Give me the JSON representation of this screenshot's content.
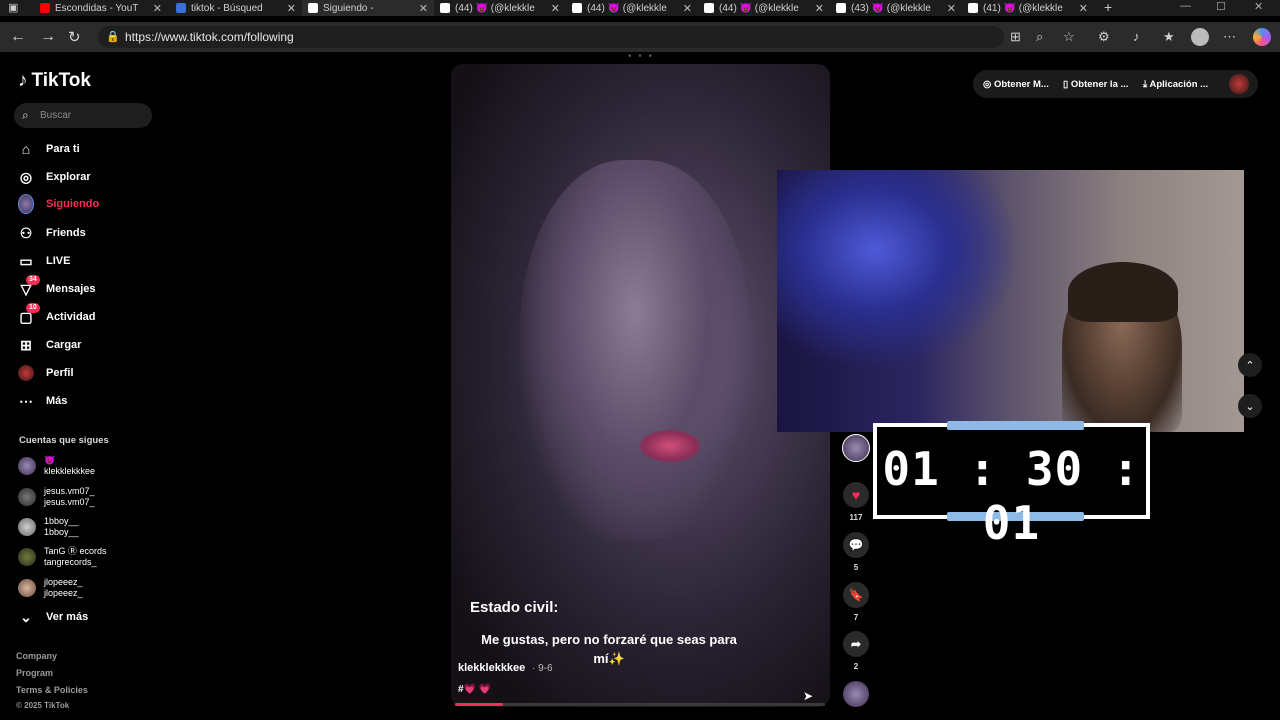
{
  "browser": {
    "tabs": [
      {
        "title": "Escondidas - YouT",
        "favicon_color": "#ff0000"
      },
      {
        "title": "tiktok - Búsqued",
        "favicon_color": "#3a6fd8"
      },
      {
        "title": "Siguiendo - ",
        "favicon_color": "#ffffff"
      },
      {
        "title": "(44) 😈 (@klekkle",
        "favicon_color": "#ffffff"
      },
      {
        "title": "(44) 😈 (@klekkle",
        "favicon_color": "#ffffff"
      },
      {
        "title": "(44) 😈 (@klekkle",
        "favicon_color": "#ffffff"
      },
      {
        "title": "(43) 😈 (@klekkle",
        "favicon_color": "#ffffff"
      },
      {
        "title": "(41) 😈 (@klekkle",
        "favicon_color": "#ffffff"
      }
    ],
    "new_tab": "+",
    "url": "https://www.tiktok.com/following"
  },
  "sidebar": {
    "logo": "TikTok",
    "search_placeholder": "Buscar",
    "items": [
      {
        "label": "Para ti",
        "icon": "home-icon"
      },
      {
        "label": "Explorar",
        "icon": "compass-icon"
      },
      {
        "label": "Siguiendo",
        "icon": "following-avatar",
        "active": true
      },
      {
        "label": "Friends",
        "icon": "friends-icon"
      },
      {
        "label": "LIVE",
        "icon": "live-icon"
      },
      {
        "label": "Mensajes",
        "icon": "messages-icon",
        "badge": "34"
      },
      {
        "label": "Actividad",
        "icon": "activity-icon",
        "badge": "10"
      },
      {
        "label": "Cargar",
        "icon": "upload-icon"
      },
      {
        "label": "Perfil",
        "icon": "profile-avatar"
      },
      {
        "label": "Más",
        "icon": "more-icon"
      }
    ],
    "following_title": "Cuentas que sigues",
    "accounts": [
      {
        "display": "😈",
        "handle": "klekklekkkee"
      },
      {
        "display": "jesus.vm07_",
        "handle": "jesus.vm07_"
      },
      {
        "display": "1bboy__",
        "handle": "1bboy__"
      },
      {
        "display": "TanG Ⓡ ecords",
        "handle": "tangrecords_"
      },
      {
        "display": "jlopeeez_",
        "handle": "jlopeeez_"
      }
    ],
    "see_more": "Ver más",
    "footer": [
      "Company",
      "Program",
      "Terms & Policies",
      "© 2025 TikTok"
    ]
  },
  "video": {
    "caption_title": "Estado civil:",
    "caption_text": "Me gustas, pero no forzaré que seas para mí✨",
    "author": "klekklekkkee",
    "date": "· 9-6",
    "tags": "#💗 💗",
    "progress": 0.13
  },
  "actions": {
    "likes": "117",
    "comments": "5",
    "saves": "7",
    "shares": "2"
  },
  "topbar": {
    "get_coins": "Obtener M...",
    "get_app": "Obtener la ...",
    "download_app": "Aplicación ..."
  },
  "timer": {
    "value": "01:30:01"
  },
  "colors": {
    "accent": "#fe2c55",
    "timer_bar": "#8fb9e6"
  }
}
